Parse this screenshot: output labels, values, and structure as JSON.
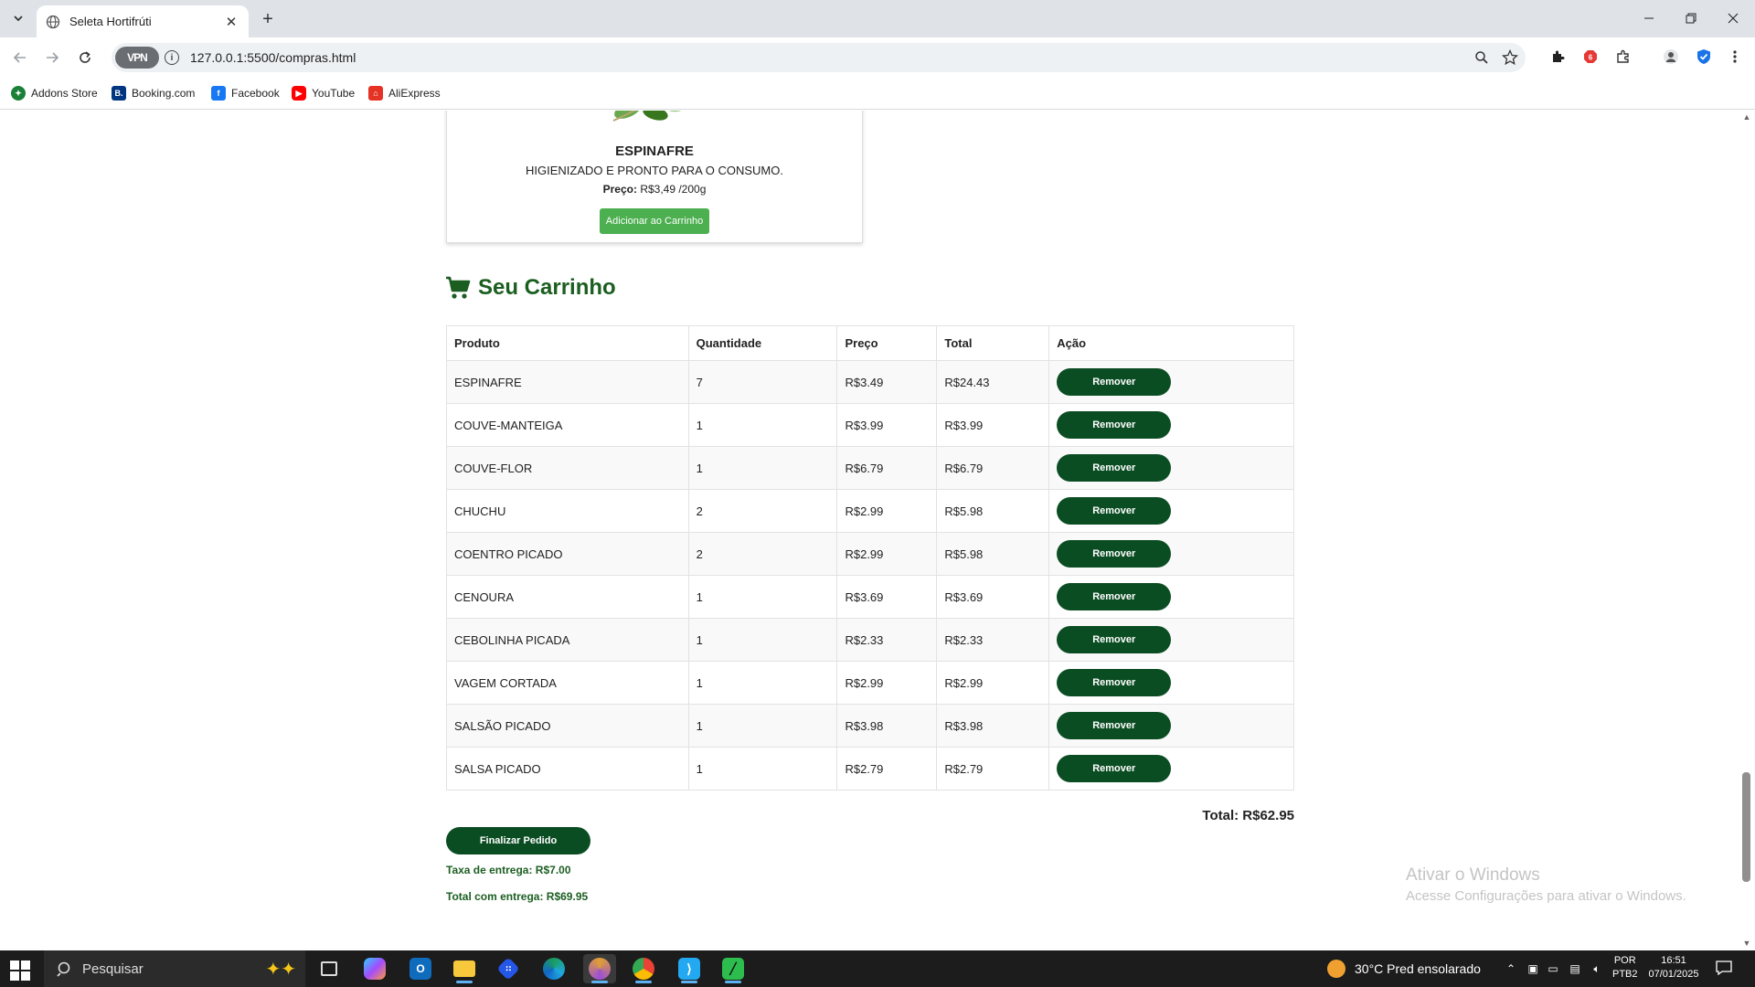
{
  "browser": {
    "tab_title": "Seleta Hortifrúti",
    "url": "127.0.0.1:5500/compras.html",
    "vpn_label": "VPN",
    "bookmarks": [
      {
        "label": "Addons Store",
        "color": "#1a7f37"
      },
      {
        "label": "Booking.com",
        "color": "#003580"
      },
      {
        "label": "Facebook",
        "color": "#1877f2"
      },
      {
        "label": "YouTube",
        "color": "#ff0000"
      },
      {
        "label": "AliExpress",
        "color": "#e43225"
      }
    ]
  },
  "product": {
    "name": "ESPINAFRE",
    "description": "HIGIENIZADO E PRONTO PARA O CONSUMO.",
    "price_label": "Preço:",
    "price_value": "R$3,49 /200g",
    "add_button": "Adicionar ao Carrinho"
  },
  "cart": {
    "heading": "Seu Carrinho",
    "columns": [
      "Produto",
      "Quantidade",
      "Preço",
      "Total",
      "Ação"
    ],
    "remove_label": "Remover",
    "rows": [
      {
        "product": "ESPINAFRE",
        "qty": "7",
        "price": "R$3.49",
        "total": "R$24.43"
      },
      {
        "product": "COUVE-MANTEIGA",
        "qty": "1",
        "price": "R$3.99",
        "total": "R$3.99"
      },
      {
        "product": "COUVE-FLOR",
        "qty": "1",
        "price": "R$6.79",
        "total": "R$6.79"
      },
      {
        "product": "CHUCHU",
        "qty": "2",
        "price": "R$2.99",
        "total": "R$5.98"
      },
      {
        "product": "COENTRO PICADO",
        "qty": "2",
        "price": "R$2.99",
        "total": "R$5.98"
      },
      {
        "product": "CENOURA",
        "qty": "1",
        "price": "R$3.69",
        "total": "R$3.69"
      },
      {
        "product": "CEBOLINHA PICADA",
        "qty": "1",
        "price": "R$2.33",
        "total": "R$2.33"
      },
      {
        "product": "VAGEM CORTADA",
        "qty": "1",
        "price": "R$2.99",
        "total": "R$2.99"
      },
      {
        "product": "SALSÃO PICADO",
        "qty": "1",
        "price": "R$3.98",
        "total": "R$3.98"
      },
      {
        "product": "SALSA PICADO",
        "qty": "1",
        "price": "R$2.79",
        "total": "R$2.79"
      }
    ],
    "total": "Total: R$62.95",
    "checkout_button": "Finalizar Pedido",
    "delivery_fee": "Taxa de entrega: R$7.00",
    "grand_total": "Total com entrega: R$69.95"
  },
  "watermark": {
    "line1": "Ativar o Windows",
    "line2": "Acesse Configurações para ativar o Windows."
  },
  "taskbar": {
    "search_placeholder": "Pesquisar",
    "weather": "30°C  Pred ensolarado",
    "lang_line1": "POR",
    "lang_line2": "PTB2",
    "time": "16:51",
    "date": "07/01/2025"
  },
  "colors": {
    "brand_green": "#1b5e20",
    "button_dark_green": "#0b4d23",
    "add_button_green": "#4caf50"
  }
}
